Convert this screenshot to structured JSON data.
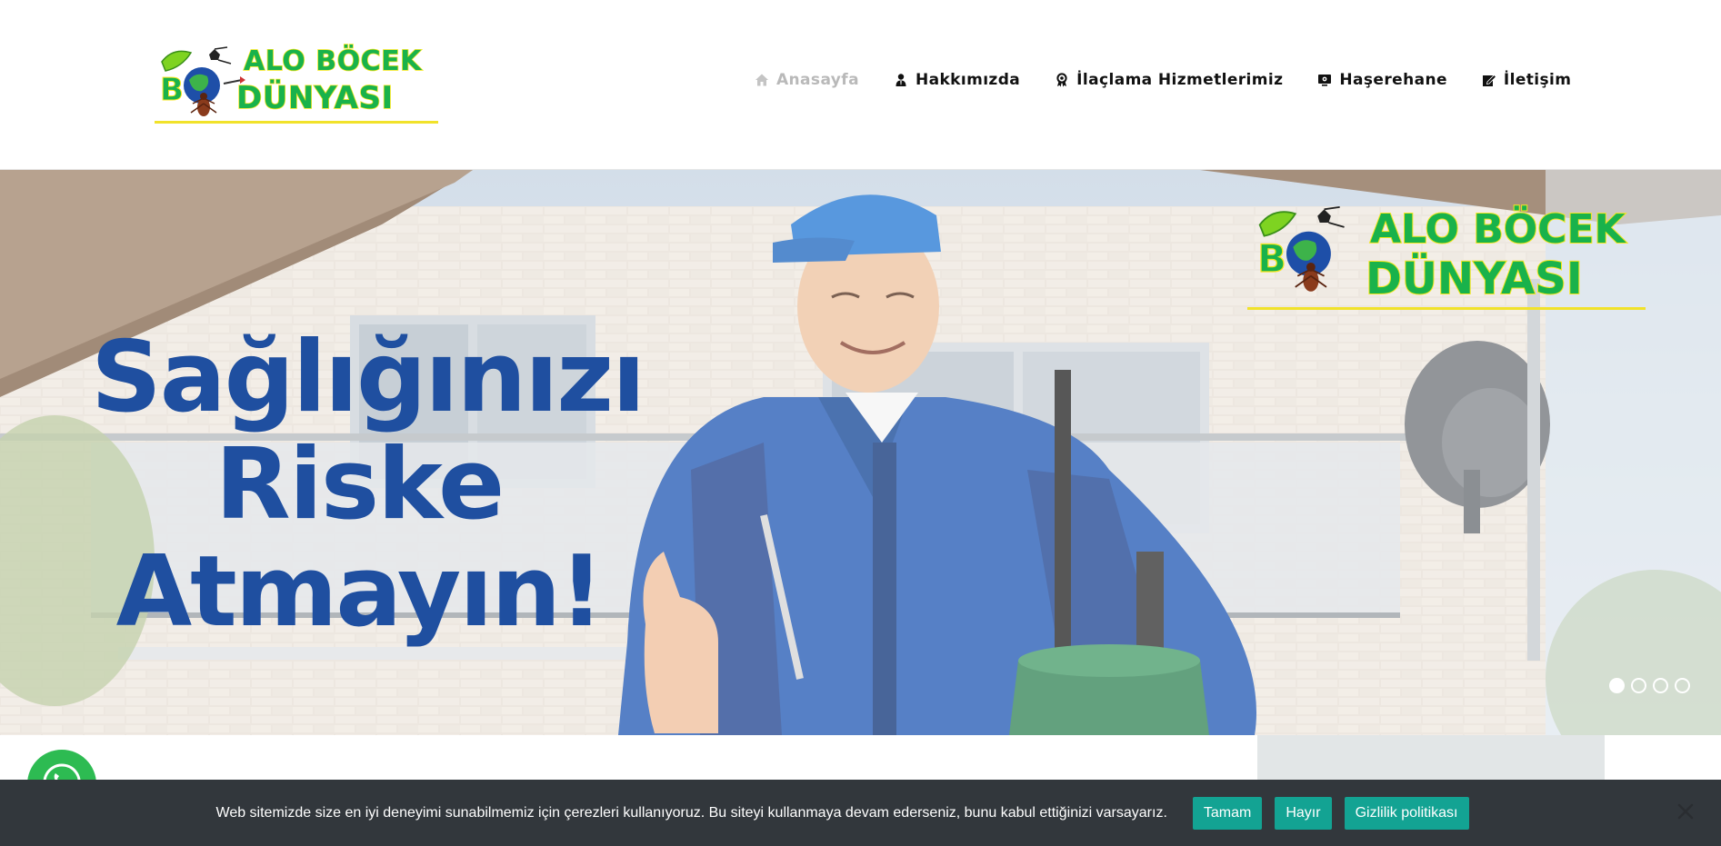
{
  "header": {
    "logo": {
      "line1": "ALO BÖCEK",
      "line2": "DÜNYASI"
    },
    "nav": [
      {
        "label": "Anasayfa",
        "icon": "home-icon",
        "active": true
      },
      {
        "label": "Hakkımızda",
        "icon": "user-icon",
        "active": false
      },
      {
        "label": "İlaçlama Hizmetlerimiz",
        "icon": "award-icon",
        "active": false
      },
      {
        "label": "Haşerehane",
        "icon": "monitor-icon",
        "active": false
      },
      {
        "label": "İletişim",
        "icon": "edit-icon",
        "active": false
      }
    ]
  },
  "hero": {
    "headline": [
      "Sağlığınızı",
      "Riske",
      "Atmayın!"
    ],
    "logo": {
      "line1": "ALO BÖCEK",
      "line2": "DÜNYASI"
    },
    "slides_total": 4,
    "slide_active": 1
  },
  "whatsapp": {
    "icon": "whatsapp-icon"
  },
  "cookie_bar": {
    "message": "Web sitemizde size en iyi deneyimi sunabilmemiz için çerezleri kullanıyoruz. Bu siteyi kullanmaya devam ederseniz, bunu kabul ettiğinizi varsayarız.",
    "accept_label": "Tamam",
    "decline_label": "Hayır",
    "policy_label": "Gizlilik politikası",
    "close_icon": "close-icon"
  },
  "colors": {
    "headline_blue": "#1f4fa0",
    "logo_green": "#19b24b",
    "logo_yellow": "#f4e61c",
    "cookie_bar_bg": "#32373c",
    "cookie_button_bg": "#13a393",
    "nav_active": "#b9b9b9"
  }
}
